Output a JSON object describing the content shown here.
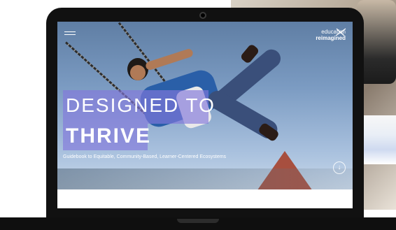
{
  "brand": {
    "top": "education",
    "bottom": "reimagined"
  },
  "hero": {
    "headline_line1": "DESIGNED TO",
    "headline_line2": "THRIVE",
    "subtitle": "Guidebook to Equitable, Community-Based, Learner-Centered Ecosystems"
  },
  "icons": {
    "menu": "hamburger-menu-icon",
    "scroll": "arrow-down-icon",
    "logo_mark": "x-mark-icon"
  },
  "colors": {
    "accent": "#8278DC",
    "text": "#FFFFFF",
    "device": "#111111"
  }
}
